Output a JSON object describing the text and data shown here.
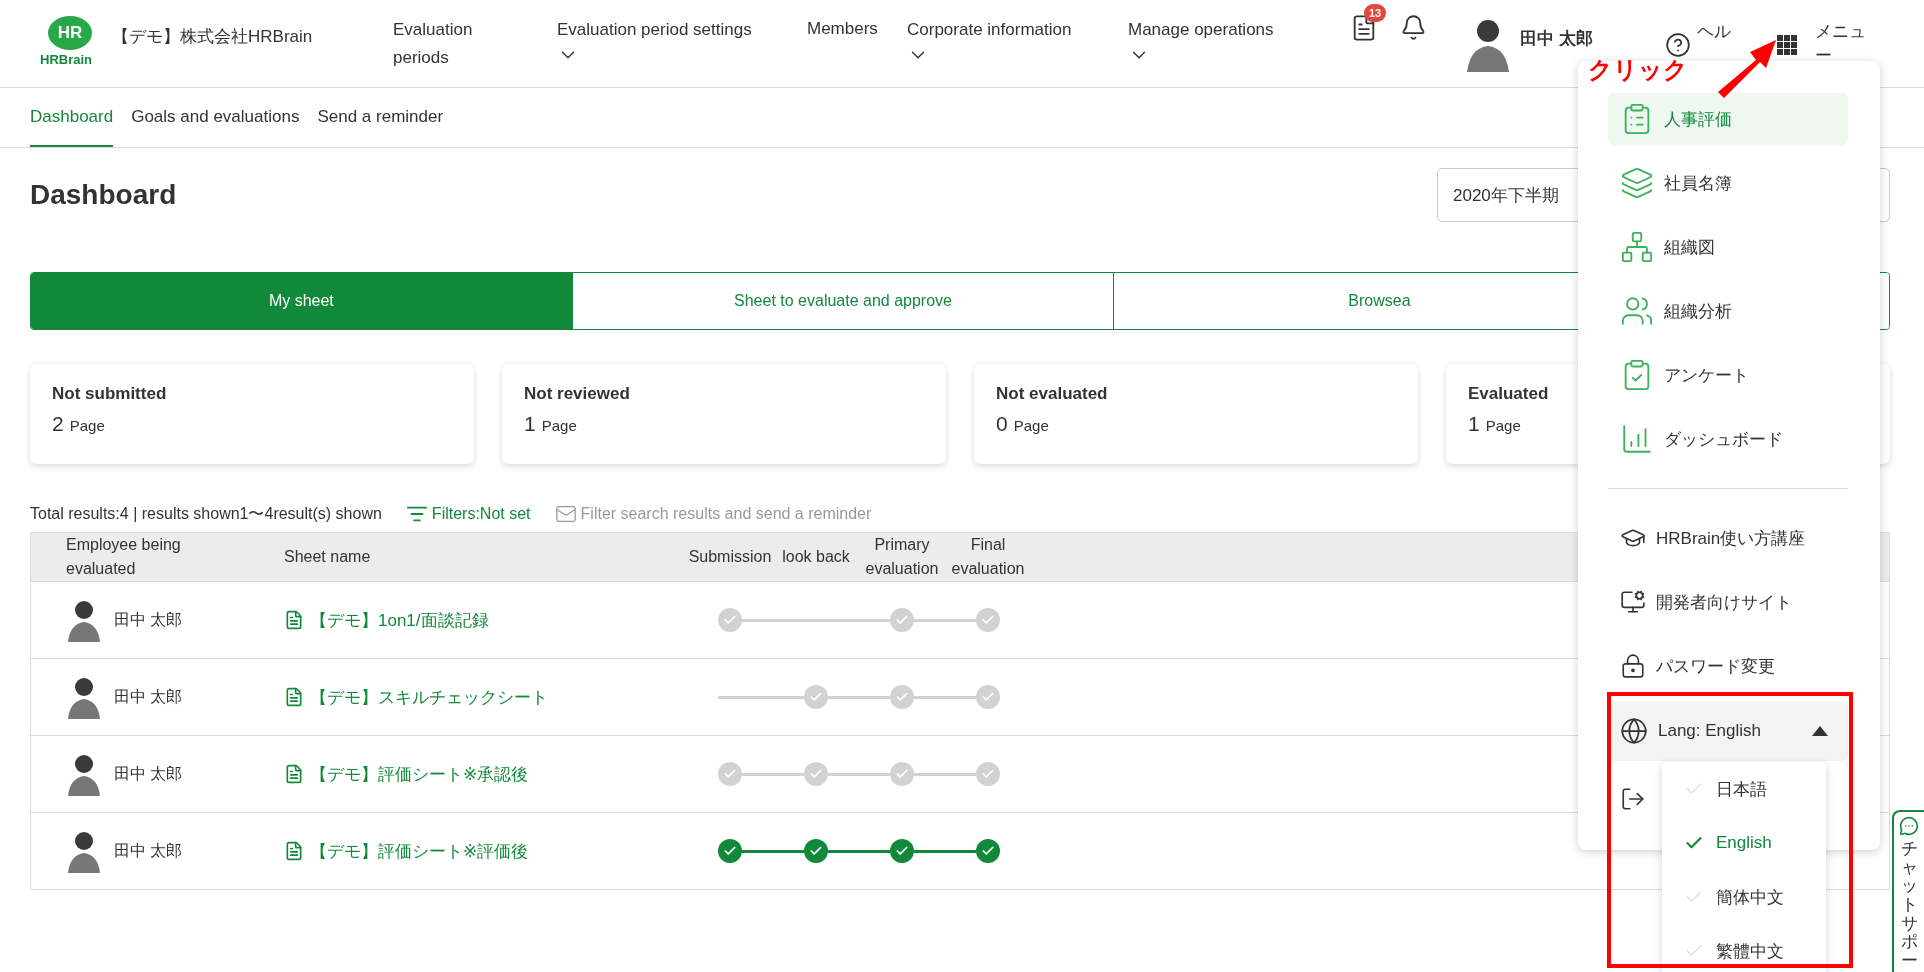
{
  "header": {
    "logo_mark": "HR",
    "logo_text": "HRBrain",
    "company": "【デモ】株式会社HRBrain",
    "nav": [
      {
        "label": "Evaluation periods",
        "dropdown": false
      },
      {
        "label": "Evaluation period settings",
        "dropdown": true
      },
      {
        "label": "Members",
        "dropdown": false
      },
      {
        "label": "Corporate information",
        "dropdown": true
      },
      {
        "label": "Manage operations",
        "dropdown": true
      }
    ],
    "notification_badge": "13",
    "user_name": "田中 太郎",
    "help_label": "ヘル",
    "menu_label": "メニュー"
  },
  "subnav": [
    {
      "label": "Dashboard",
      "selected": true
    },
    {
      "label": "Goals and evaluations",
      "selected": false
    },
    {
      "label": "Send a reminder",
      "selected": false
    }
  ],
  "page_title": "Dashboard",
  "period_select": {
    "value": "2020年下半期"
  },
  "sheet_tabs": [
    {
      "label": "My sheet",
      "selected": true
    },
    {
      "label": "Sheet to evaluate and approve",
      "selected": false
    },
    {
      "label": "Browsea",
      "selected": false
    }
  ],
  "status_cards": [
    {
      "title": "Not submitted",
      "count": "2",
      "unit": "Page"
    },
    {
      "title": "Not reviewed",
      "count": "1",
      "unit": "Page"
    },
    {
      "title": "Not evaluated",
      "count": "0",
      "unit": "Page"
    },
    {
      "title": "Evaluated",
      "count": "1",
      "unit": "Page"
    }
  ],
  "summary": {
    "totals": "Total results:4 | results shown1〜4result(s) shown",
    "filter": "Filters:Not set",
    "reminder": "Filter search results and send a reminder",
    "reminder_disabled": true
  },
  "table": {
    "columns": [
      "Employee being evaluated",
      "Sheet name",
      "Submission",
      "look back",
      "Primary evaluation",
      "Final evaluation"
    ],
    "rows": [
      {
        "employee": "田中 太郎",
        "sheet": "【デモ】1on1/面談記録",
        "steps": [
          {
            "shown": true,
            "done": false
          },
          {
            "shown": false
          },
          {
            "shown": true,
            "done": false
          },
          {
            "shown": true,
            "done": false
          }
        ]
      },
      {
        "employee": "田中 太郎",
        "sheet": "【デモ】スキルチェックシート",
        "steps": [
          {
            "shown": false
          },
          {
            "shown": true,
            "done": false
          },
          {
            "shown": true,
            "done": false
          },
          {
            "shown": true,
            "done": false
          }
        ]
      },
      {
        "employee": "田中 太郎",
        "sheet": "【デモ】評価シート※承認後",
        "steps": [
          {
            "shown": true,
            "done": false
          },
          {
            "shown": true,
            "done": false
          },
          {
            "shown": true,
            "done": false
          },
          {
            "shown": true,
            "done": false
          }
        ]
      },
      {
        "employee": "田中 太郎",
        "sheet": "【デモ】評価シート※評価後",
        "steps": [
          {
            "shown": true,
            "done": true
          },
          {
            "shown": true,
            "done": true
          },
          {
            "shown": true,
            "done": true
          },
          {
            "shown": true,
            "done": true
          }
        ]
      }
    ]
  },
  "app_menu": {
    "apps": [
      {
        "label": "人事評価",
        "selected": true
      },
      {
        "label": "社員名簿",
        "selected": false
      },
      {
        "label": "組織図",
        "selected": false
      },
      {
        "label": "組織分析",
        "selected": false
      },
      {
        "label": "アンケート",
        "selected": false
      },
      {
        "label": "ダッシュボード",
        "selected": false
      }
    ],
    "links": [
      "HRBrain使い方講座",
      "開発者向けサイト",
      "パスワード変更"
    ],
    "language": {
      "label": "Lang: English",
      "expanded": true,
      "options": [
        {
          "label": "日本語",
          "selected": false
        },
        {
          "label": "English",
          "selected": true
        },
        {
          "label": "簡体中文",
          "selected": false
        },
        {
          "label": "繁體中文",
          "selected": false
        }
      ]
    }
  },
  "annotation": {
    "label": "クリック"
  },
  "chat_tab": {
    "label": "チャットサポー"
  }
}
